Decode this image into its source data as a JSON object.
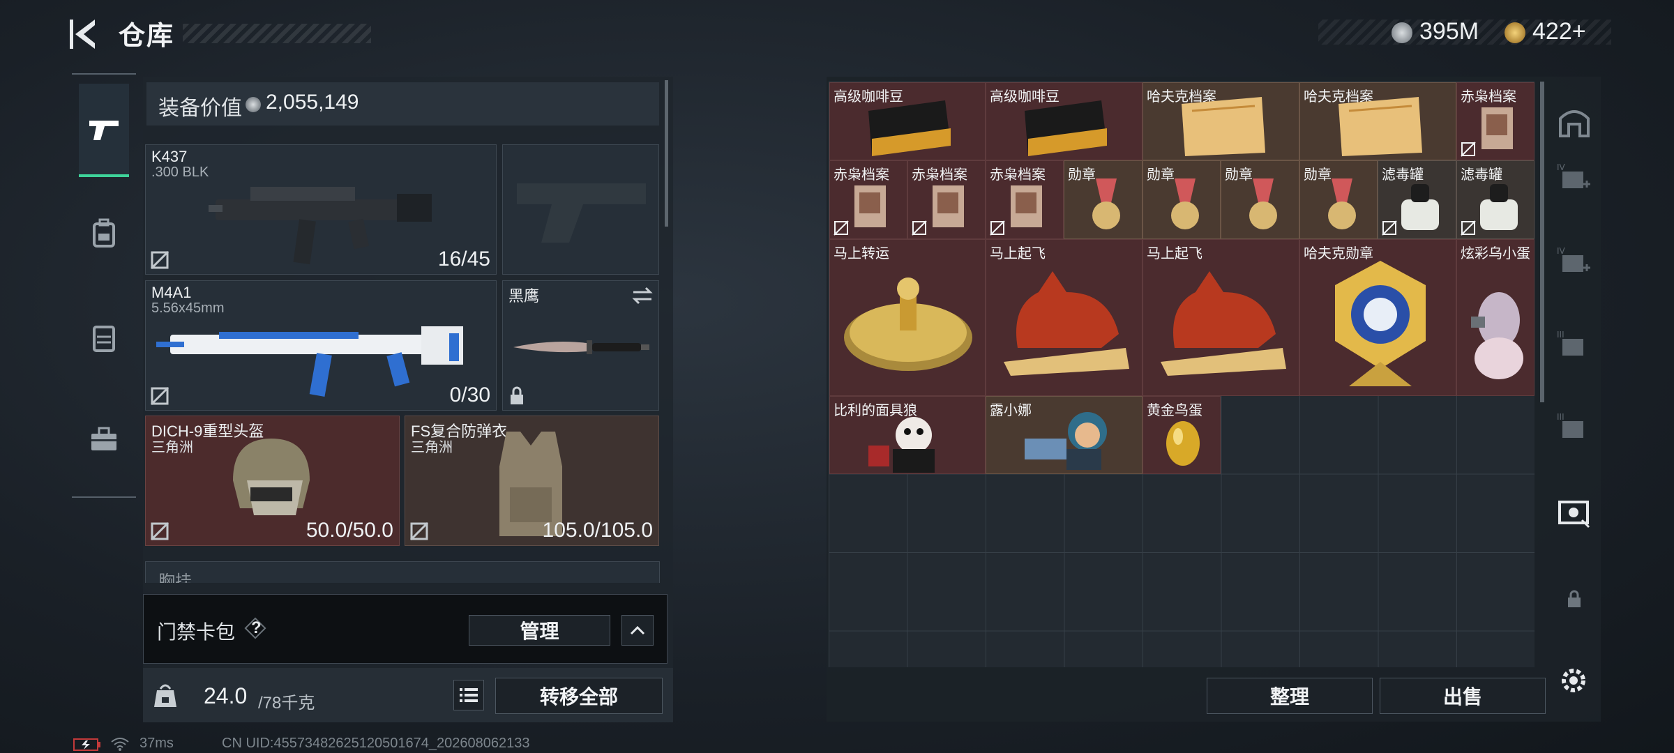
{
  "header": {
    "title": "仓库"
  },
  "currency": {
    "silver_value": "395M",
    "gold_value": "422+"
  },
  "colors": {
    "accent": "#3ed39a",
    "item_red": "#4b2b2e",
    "item_gold": "#4a3a30"
  },
  "equipment": {
    "value_label": "装备价值",
    "value_amount": "2,055,149",
    "slots": {
      "primary": {
        "name": "K437",
        "ammo": ".300 BLK",
        "count": "16/45"
      },
      "secondary": {
        "name": "M4A1",
        "ammo": "5.56x45mm",
        "count": "0/30"
      },
      "melee": {
        "name": "黑鹰"
      },
      "helmet": {
        "name": "DICH-9重型头盔",
        "map": "三角洲",
        "durability": "50.0/50.0"
      },
      "armor": {
        "name": "FS复合防弹衣",
        "map": "三角洲",
        "durability": "105.0/105.0"
      },
      "chest": {
        "name": "胸挂"
      }
    },
    "keycard": {
      "label": "门禁卡包",
      "help": "?",
      "manage_label": "管理"
    },
    "weight": {
      "current": "24.0",
      "capacity": "/78千克"
    },
    "transfer_all_label": "转移全部"
  },
  "warehouse": {
    "items": [
      {
        "label": "高级咖啡豆"
      },
      {
        "label": "高级咖啡豆"
      },
      {
        "label": "哈夫克档案"
      },
      {
        "label": "哈夫克档案"
      },
      {
        "label": "赤枭档案"
      },
      {
        "label": "赤枭档案"
      },
      {
        "label": "赤枭档案"
      },
      {
        "label": "赤枭档案"
      },
      {
        "label": "勋章"
      },
      {
        "label": "勋章"
      },
      {
        "label": "勋章"
      },
      {
        "label": "勋章"
      },
      {
        "label": "滤毒罐"
      },
      {
        "label": "滤毒罐"
      },
      {
        "label": "马上转运"
      },
      {
        "label": "马上起飞"
      },
      {
        "label": "马上起飞"
      },
      {
        "label": "哈夫克勋章"
      },
      {
        "label": "炫彩乌小蛋"
      },
      {
        "label": "比利的面具狼"
      },
      {
        "label": "露小娜"
      },
      {
        "label": "黄金鸟蛋"
      }
    ],
    "sort_label": "整理",
    "sell_label": "出售"
  },
  "status_bar": {
    "ping": "37ms",
    "uid": "CN UID:4557348262512050167​4_202608062133"
  }
}
